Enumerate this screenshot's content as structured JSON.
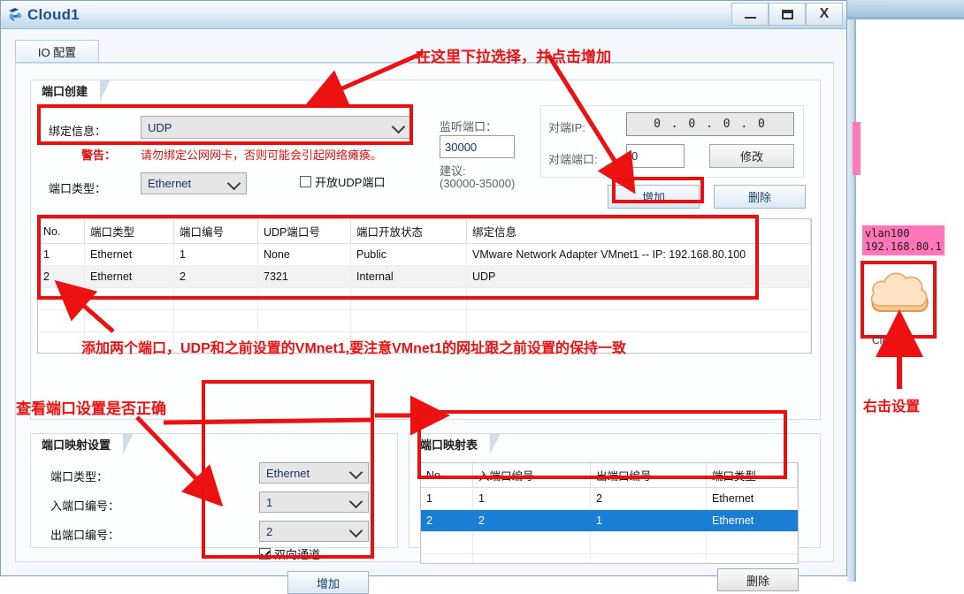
{
  "window": {
    "title": "Cloud1",
    "icon": "cloud-device-icon",
    "buttons": {
      "minimize": "–",
      "maximize": "□",
      "close": "X"
    }
  },
  "tabs": [
    {
      "label": "IO 配置"
    }
  ],
  "groups": {
    "create": {
      "title": "端口创建"
    },
    "map_settings": {
      "title": "端口映射设置"
    },
    "map_table": {
      "title": "端口映射表"
    }
  },
  "create": {
    "bind_label": "绑定信息：",
    "bind_value": "UDP",
    "warn_label": "警告：",
    "warn_text": "请勿绑定公网网卡，否则可能会引起网络瘫痪。",
    "port_type_label": "端口类型：",
    "port_type_value": "Ethernet",
    "udp_checkbox_label": "开放UDP端口",
    "udp_checkbox_checked": false,
    "listen_port_label": "监听端口：",
    "listen_port_value": "30000",
    "suggest_label": "建议:",
    "suggest_range": "(30000-35000)",
    "peer_ip_label": "对端IP:",
    "peer_ip_value": "0 . 0 . 0 . 0",
    "peer_port_label": "对端端口:",
    "peer_port_value": "0",
    "modify_button": "修改",
    "add_button": "增加",
    "delete_button": "删除"
  },
  "port_table": {
    "headers": [
      "No.",
      "端口类型",
      "端口编号",
      "UDP端口号",
      "端口开放状态",
      "绑定信息"
    ],
    "rows": [
      [
        "1",
        "Ethernet",
        "1",
        "None",
        "Public",
        "VMware Network Adapter VMnet1 -- IP: 192.168.80.100"
      ],
      [
        "2",
        "Ethernet",
        "2",
        "7321",
        "Internal",
        "UDP"
      ]
    ],
    "empty_rows": 3
  },
  "map_settings": {
    "port_type_label": "端口类型：",
    "port_type_value": "Ethernet",
    "in_port_label": "入端口编号：",
    "in_port_value": "1",
    "out_port_label": "出端口编号：",
    "out_port_value": "2",
    "bidirectional_label": "双向通道",
    "bidirectional_checked": true,
    "add_button": "增加"
  },
  "map_table": {
    "headers": [
      "No.",
      "入端口编号",
      "出端口编号",
      "端口类型"
    ],
    "rows": [
      {
        "cells": [
          "1",
          "1",
          "2",
          "Ethernet"
        ],
        "selected": false
      },
      {
        "cells": [
          "2",
          "2",
          "1",
          "Ethernet"
        ],
        "selected": true
      }
    ],
    "empty_rows": 3,
    "delete_button": "删除"
  },
  "canvas": {
    "vlan_label_line1": "vlan100",
    "vlan_label_line2": "192.168.80.1",
    "device_name": "Cloud1"
  },
  "annotations": {
    "top": "在这里下拉选择，并点击增加",
    "middle": "添加两个端口，UDP和之前设置的VMnet1,要注意VMnet1的网址跟之前设置的保持一致",
    "bottom_left": "查看端口设置是否正确",
    "right": "右击设置"
  },
  "colors": {
    "annotation_red": "#ee1111",
    "selection_blue": "#1a7fd4",
    "title_blue": "#1d4f8f",
    "vlan_pink": "#ff77b8"
  }
}
